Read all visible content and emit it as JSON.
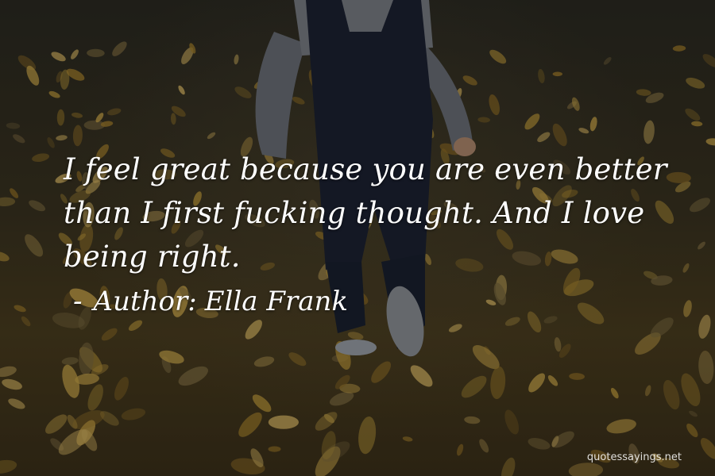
{
  "quote": {
    "text": "I feel great because you are even better than I first fucking thought. And I love being right.",
    "author_dash": "-",
    "author_prefix": "Author:",
    "author_name": "Ella Frank"
  },
  "watermark": {
    "text": "quotessayings.net"
  },
  "background": {
    "subject": "child-walking-on-autumn-leaves",
    "colors": {
      "ground": "#4a3d1f",
      "leaf": "#b8953a",
      "overalls": "#1c2233",
      "sweater": "#6b6f78"
    }
  }
}
